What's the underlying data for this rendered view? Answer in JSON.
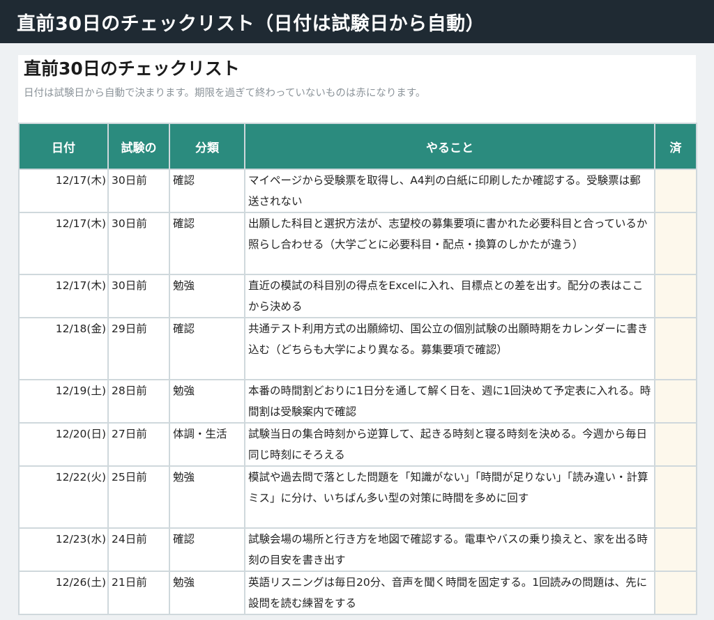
{
  "header": {
    "title": "直前30日のチェックリスト（日付は試験日から自動）"
  },
  "panel": {
    "title": "直前30日のチェックリスト",
    "subtitle": "日付は試験日から自動で決まります。期限を過ぎて終わっていないものは赤になります。"
  },
  "table": {
    "columns": {
      "date": "日付",
      "days": "試験の",
      "category": "分類",
      "task": "やること",
      "done": "済"
    },
    "rows": [
      {
        "date": "12/17(木)",
        "days": "30日前",
        "category": "確認",
        "task": "マイページから受験票を取得し、A4判の白紙に印刷したか確認する。受験票は郵送されない"
      },
      {
        "date": "12/17(木)",
        "days": "30日前",
        "category": "確認",
        "task": "出願した科目と選択方法が、志望校の募集要項に書かれた必要科目と合っているか照らし合わせる（大学ごとに必要科目・配点・換算のしかたが違う）"
      },
      {
        "date": "12/17(木)",
        "days": "30日前",
        "category": "勉強",
        "task": "直近の模試の科目別の得点をExcelに入れ、目標点との差を出す。配分の表はここから決める"
      },
      {
        "date": "12/18(金)",
        "days": "29日前",
        "category": "確認",
        "task": "共通テスト利用方式の出願締切、国公立の個別試験の出願時期をカレンダーに書き込む（どちらも大学により異なる。募集要項で確認）"
      },
      {
        "date": "12/19(土)",
        "days": "28日前",
        "category": "勉強",
        "task": "本番の時間割どおりに1日分を通して解く日を、週に1回決めて予定表に入れる。時間割は受験案内で確認"
      },
      {
        "date": "12/20(日)",
        "days": "27日前",
        "category": "体調・生活",
        "task": "試験当日の集合時刻から逆算して、起きる時刻と寝る時刻を決める。今週から毎日同じ時刻にそろえる"
      },
      {
        "date": "12/22(火)",
        "days": "25日前",
        "category": "勉強",
        "task": "模試や過去問で落とした問題を「知識がない」「時間が足りない」「読み違い・計算ミス」に分け、いちばん多い型の対策に時間を多めに回す"
      },
      {
        "date": "12/23(水)",
        "days": "24日前",
        "category": "確認",
        "task": "試験会場の場所と行き方を地図で確認する。電車やバスの乗り換えと、家を出る時刻の目安を書き出す"
      },
      {
        "date": "12/26(土)",
        "days": "21日前",
        "category": "勉強",
        "task": "英語リスニングは毎日20分、音声を聞く時間を固定する。1回読みの問題は、先に設問を読む練習をする"
      }
    ]
  }
}
